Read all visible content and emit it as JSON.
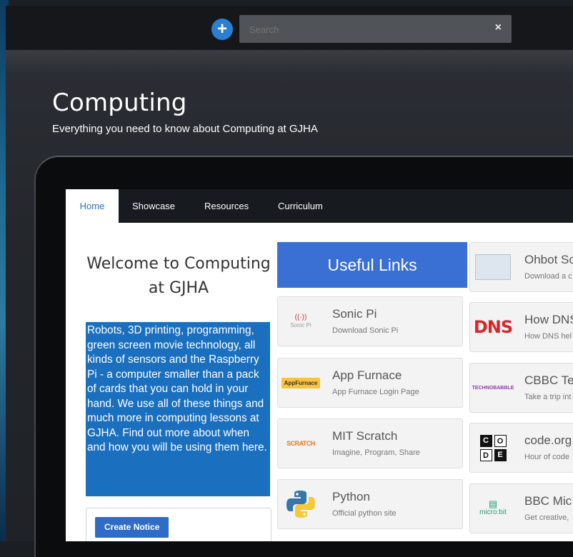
{
  "search": {
    "placeholder": "Search",
    "clear": "×",
    "add": "+"
  },
  "page": {
    "title": "Computing",
    "subtitle": "Everything you need to know about Computing at GJHA"
  },
  "tabs": [
    {
      "label": "Home",
      "active": true
    },
    {
      "label": "Showcase",
      "active": false
    },
    {
      "label": "Resources",
      "active": false
    },
    {
      "label": "Curriculum",
      "active": false
    }
  ],
  "welcome": {
    "heading": "Welcome to Computing at GJHA",
    "body": "Robots, 3D printing, programming, green screen movie technology, all kinds of sensors and the Raspberry Pi - a computer smaller than a pack of cards that you can hold in your hand. We use all of these things and much more in computing lessons at GJHA. Find out more about when and how you will be using them here."
  },
  "notice": {
    "button": "Create Notice"
  },
  "useful_links": {
    "header": "Useful Links",
    "column1": [
      {
        "title": "Sonic Pi",
        "subtitle": "Download Sonic Pi",
        "icon": "sonic-pi-logo",
        "icon_text": "((·))",
        "icon_sub": "Sonic Pi"
      },
      {
        "title": "App Furnace",
        "subtitle": "App Furnace Login Page",
        "icon": "app-furnace-logo",
        "icon_text": "AppFurnace"
      },
      {
        "title": "MIT Scratch",
        "subtitle": "Imagine, Program, Share",
        "icon": "scratch-logo",
        "icon_text": "SCRATCH"
      },
      {
        "title": "Python",
        "subtitle": "Official python site",
        "icon": "python-logo"
      }
    ],
    "column2": [
      {
        "title": "Ohbot Sc",
        "subtitle": "Download a c",
        "icon": "ohbot-logo"
      },
      {
        "title": "How DNS",
        "subtitle": "How DNS hel",
        "icon": "dns-logo",
        "icon_text": "DNS"
      },
      {
        "title": "CBBC Te",
        "subtitle": "Take a trip int",
        "icon": "cbbc-logo",
        "icon_text": "TECHNOBABBLE"
      },
      {
        "title": "code.org",
        "subtitle": "Hour of code",
        "icon": "code-org-logo",
        "icon_letters": [
          "C",
          "O",
          "D",
          "E"
        ]
      },
      {
        "title": "BBC Mic",
        "subtitle": "Get creative,",
        "icon": "microbit-logo",
        "icon_text": "micro:bit"
      }
    ]
  },
  "colors": {
    "accent": "#3a6fd3",
    "tab_active": "#2f6cc7",
    "highlight": "#1a6fbf",
    "topbar": "#15171a"
  }
}
